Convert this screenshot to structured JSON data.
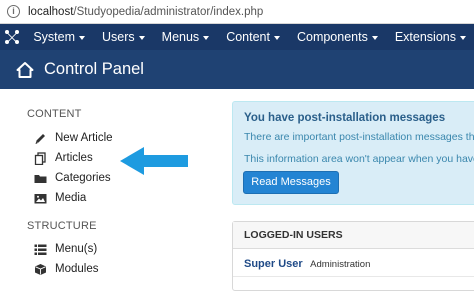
{
  "browser": {
    "url_host": "localhost",
    "url_path": "/Studyopedia/administrator/index.php"
  },
  "navbar": {
    "items": [
      {
        "label": "System"
      },
      {
        "label": "Users"
      },
      {
        "label": "Menus"
      },
      {
        "label": "Content"
      },
      {
        "label": "Components"
      },
      {
        "label": "Extensions"
      }
    ]
  },
  "header": {
    "title": "Control Panel"
  },
  "sidebar": {
    "content_section": "CONTENT",
    "content_items": [
      {
        "label": "New Article",
        "icon": "pencil-icon"
      },
      {
        "label": "Articles",
        "icon": "copy-icon"
      },
      {
        "label": "Categories",
        "icon": "folder-icon"
      },
      {
        "label": "Media",
        "icon": "image-icon"
      }
    ],
    "structure_section": "STRUCTURE",
    "structure_items": [
      {
        "label": "Menu(s)",
        "icon": "list-icon"
      },
      {
        "label": "Modules",
        "icon": "cube-icon"
      }
    ]
  },
  "messages": {
    "title": "You have post-installation messages",
    "line1": "There are important post-installation messages that",
    "line2": "This information area won't appear when you have",
    "button": "Read Messages"
  },
  "logged_in": {
    "heading": "LOGGED-IN USERS",
    "users": [
      {
        "name": "Super User",
        "role": "Administration"
      }
    ]
  },
  "colors": {
    "navbar": "#1a3867",
    "header": "#1f4273",
    "info_bg": "#d9edf7",
    "button": "#2384d3",
    "arrow": "#1e9be0"
  }
}
